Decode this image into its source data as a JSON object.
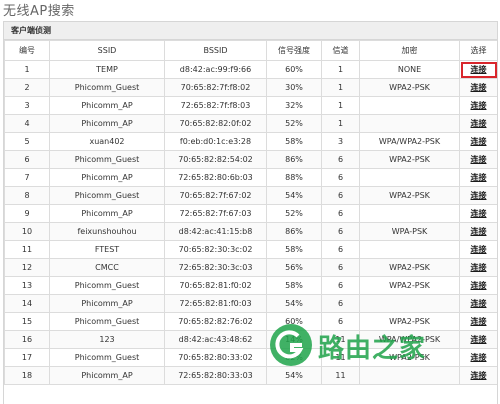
{
  "page": {
    "title": "无线AP搜索"
  },
  "panel": {
    "title": "客户端侦测"
  },
  "table": {
    "headers": [
      "编号",
      "SSID",
      "BSSID",
      "信号强度",
      "信道",
      "加密",
      "选择"
    ],
    "action_label": "连接",
    "rows": [
      {
        "num": "1",
        "ssid": "TEMP",
        "bssid": "d8:42:ac:99:f9:66",
        "signal": "60%",
        "channel": "1",
        "enc": "NONE"
      },
      {
        "num": "2",
        "ssid": "Phicomm_Guest",
        "bssid": "70:65:82:7f:f8:02",
        "signal": "30%",
        "channel": "1",
        "enc": "WPA2-PSK"
      },
      {
        "num": "3",
        "ssid": "Phicomm_AP",
        "bssid": "72:65:82:7f:f8:03",
        "signal": "32%",
        "channel": "1",
        "enc": ""
      },
      {
        "num": "4",
        "ssid": "Phicomm_AP",
        "bssid": "70:65:82:82:0f:02",
        "signal": "52%",
        "channel": "1",
        "enc": ""
      },
      {
        "num": "5",
        "ssid": "xuan402",
        "bssid": "f0:eb:d0:1c:e3:28",
        "signal": "58%",
        "channel": "3",
        "enc": "WPA/WPA2-PSK"
      },
      {
        "num": "6",
        "ssid": "Phicomm_Guest",
        "bssid": "70:65:82:82:54:02",
        "signal": "86%",
        "channel": "6",
        "enc": "WPA2-PSK"
      },
      {
        "num": "7",
        "ssid": "Phicomm_AP",
        "bssid": "72:65:82:80:6b:03",
        "signal": "88%",
        "channel": "6",
        "enc": ""
      },
      {
        "num": "8",
        "ssid": "Phicomm_Guest",
        "bssid": "70:65:82:7f:67:02",
        "signal": "54%",
        "channel": "6",
        "enc": "WPA2-PSK"
      },
      {
        "num": "9",
        "ssid": "Phicomm_AP",
        "bssid": "72:65:82:7f:67:03",
        "signal": "52%",
        "channel": "6",
        "enc": ""
      },
      {
        "num": "10",
        "ssid": "feixunshouhou",
        "bssid": "d8:42:ac:41:15:b8",
        "signal": "86%",
        "channel": "6",
        "enc": "WPA-PSK"
      },
      {
        "num": "11",
        "ssid": "FTEST",
        "bssid": "70:65:82:30:3c:02",
        "signal": "58%",
        "channel": "6",
        "enc": ""
      },
      {
        "num": "12",
        "ssid": "CMCC",
        "bssid": "72:65:82:30:3c:03",
        "signal": "56%",
        "channel": "6",
        "enc": "WPA2-PSK"
      },
      {
        "num": "13",
        "ssid": "Phicomm_Guest",
        "bssid": "70:65:82:81:f0:02",
        "signal": "58%",
        "channel": "6",
        "enc": "WPA2-PSK"
      },
      {
        "num": "14",
        "ssid": "Phicomm_AP",
        "bssid": "72:65:82:81:f0:03",
        "signal": "54%",
        "channel": "6",
        "enc": ""
      },
      {
        "num": "15",
        "ssid": "Phicomm_Guest",
        "bssid": "70:65:82:82:76:02",
        "signal": "60%",
        "channel": "6",
        "enc": "WPA2-PSK"
      },
      {
        "num": "16",
        "ssid": "123",
        "bssid": "d8:42:ac:43:48:62",
        "signal": "14%",
        "channel": "11",
        "enc": "WPA/WPA2-PSK"
      },
      {
        "num": "17",
        "ssid": "Phicomm_Guest",
        "bssid": "70:65:82:80:33:02",
        "signal": "62%",
        "channel": "11",
        "enc": "WPA2-PSK"
      },
      {
        "num": "18",
        "ssid": "Phicomm_AP",
        "bssid": "72:65:82:80:33:03",
        "signal": "54%",
        "channel": "11",
        "enc": ""
      }
    ]
  },
  "highlight_row_index": 0,
  "watermark": {
    "text": "路由之家",
    "icon": "router-home-logo-icon",
    "color": "#1fa34a"
  },
  "colors": {
    "highlight": "#d9262c"
  }
}
